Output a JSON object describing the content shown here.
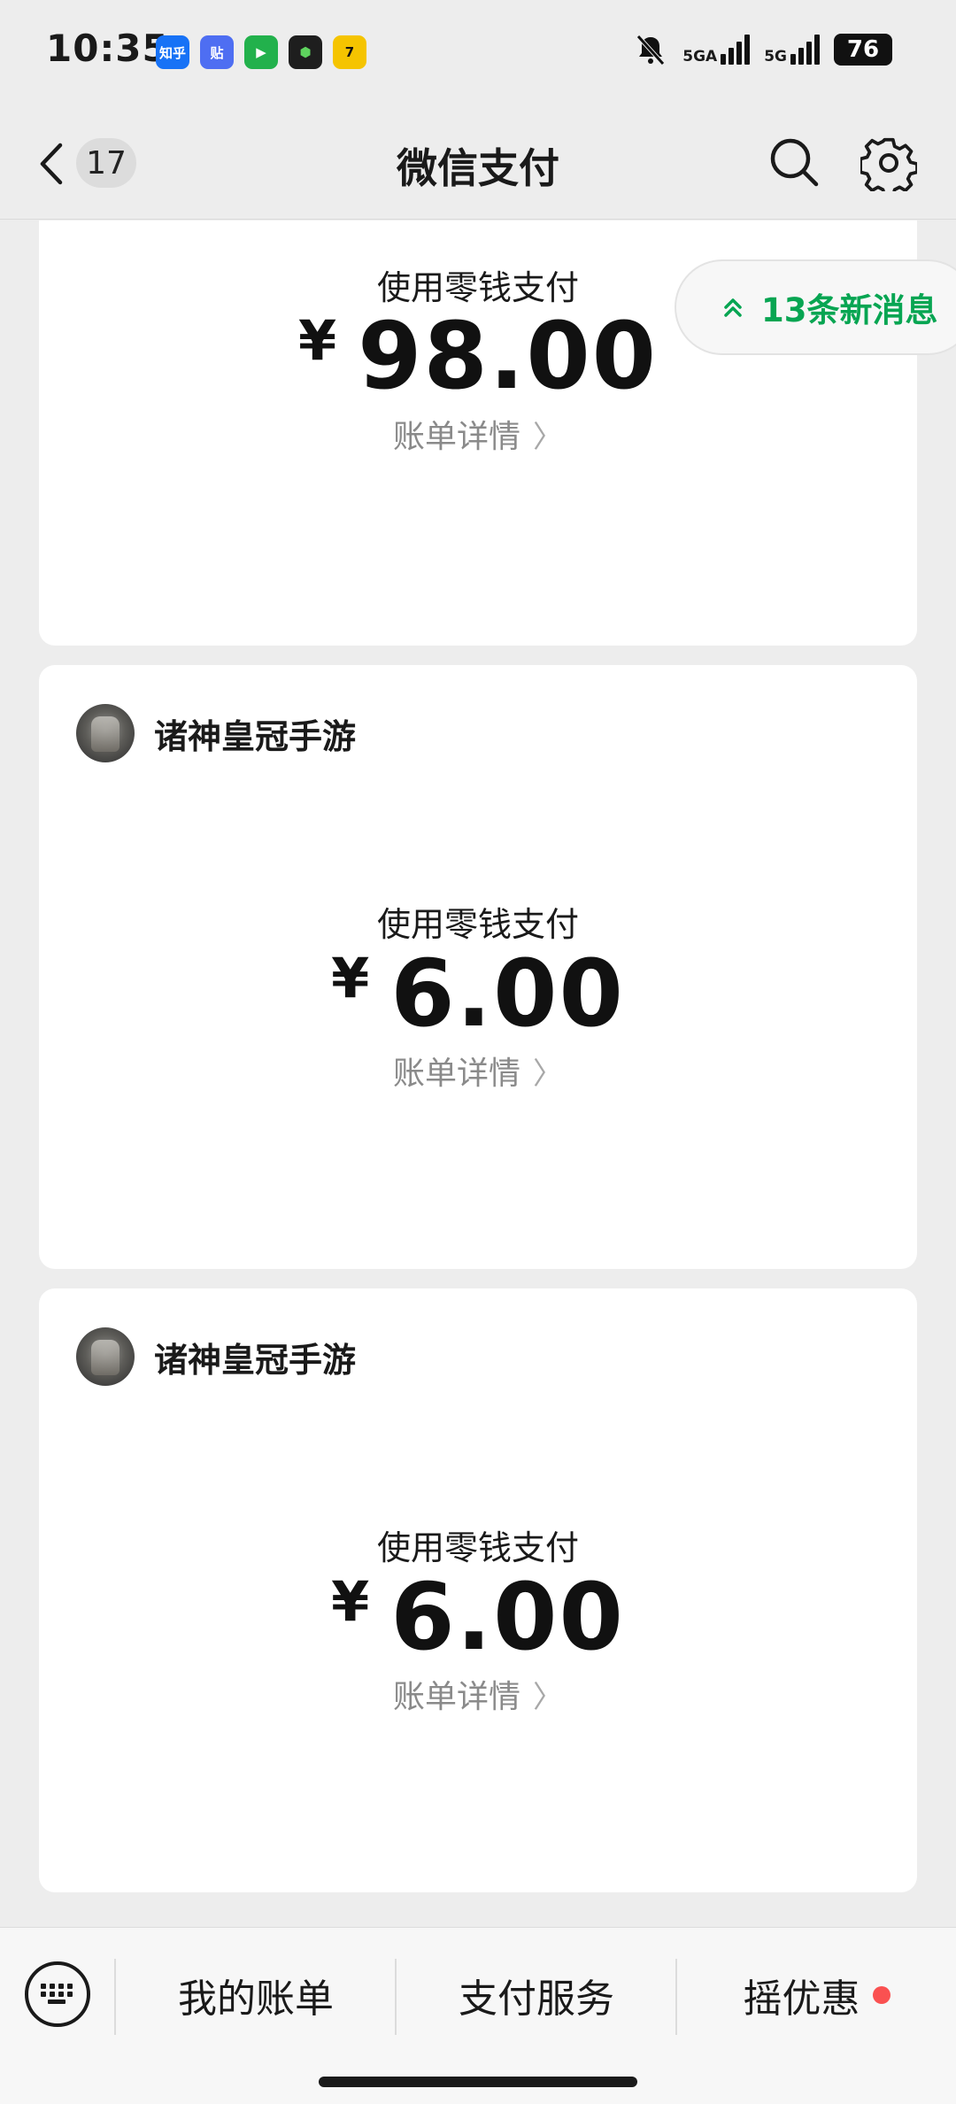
{
  "status_bar": {
    "time": "10:35",
    "app_icons": [
      {
        "name": "zhihu-app-icon",
        "label": "知乎",
        "color": "#1772f6"
      },
      {
        "name": "tieba-app-icon",
        "label": "贴",
        "color": "#4e6ef2"
      },
      {
        "name": "iqiyi-app-icon",
        "label": "▶",
        "color": "#22b14c"
      },
      {
        "name": "green-box-app-icon",
        "label": "⬢",
        "color": "#1e1e1e"
      },
      {
        "name": "seven-cat-app-icon",
        "label": "7",
        "color": "#f5c400"
      }
    ],
    "network_1": "5GA",
    "network_2": "5G",
    "battery": "76"
  },
  "nav": {
    "unread_count": "17",
    "title": "微信支付"
  },
  "new_messages": "13条新消息",
  "payments": [
    {
      "merchant": "",
      "method": "使用零钱支付",
      "currency": "¥",
      "amount": "98.00",
      "detail": "账单详情"
    },
    {
      "merchant": "诸神皇冠手游",
      "method": "使用零钱支付",
      "currency": "¥",
      "amount": "6.00",
      "detail": "账单详情"
    },
    {
      "merchant": "诸神皇冠手游",
      "method": "使用零钱支付",
      "currency": "¥",
      "amount": "6.00",
      "detail": "账单详情"
    }
  ],
  "bottom_menu": {
    "my_bills": "我的账单",
    "pay_services": "支付服务",
    "shake_offers": "摇优惠"
  },
  "colors": {
    "accent_green": "#07a552",
    "badge_red": "#fa5151",
    "background": "#ededed"
  }
}
